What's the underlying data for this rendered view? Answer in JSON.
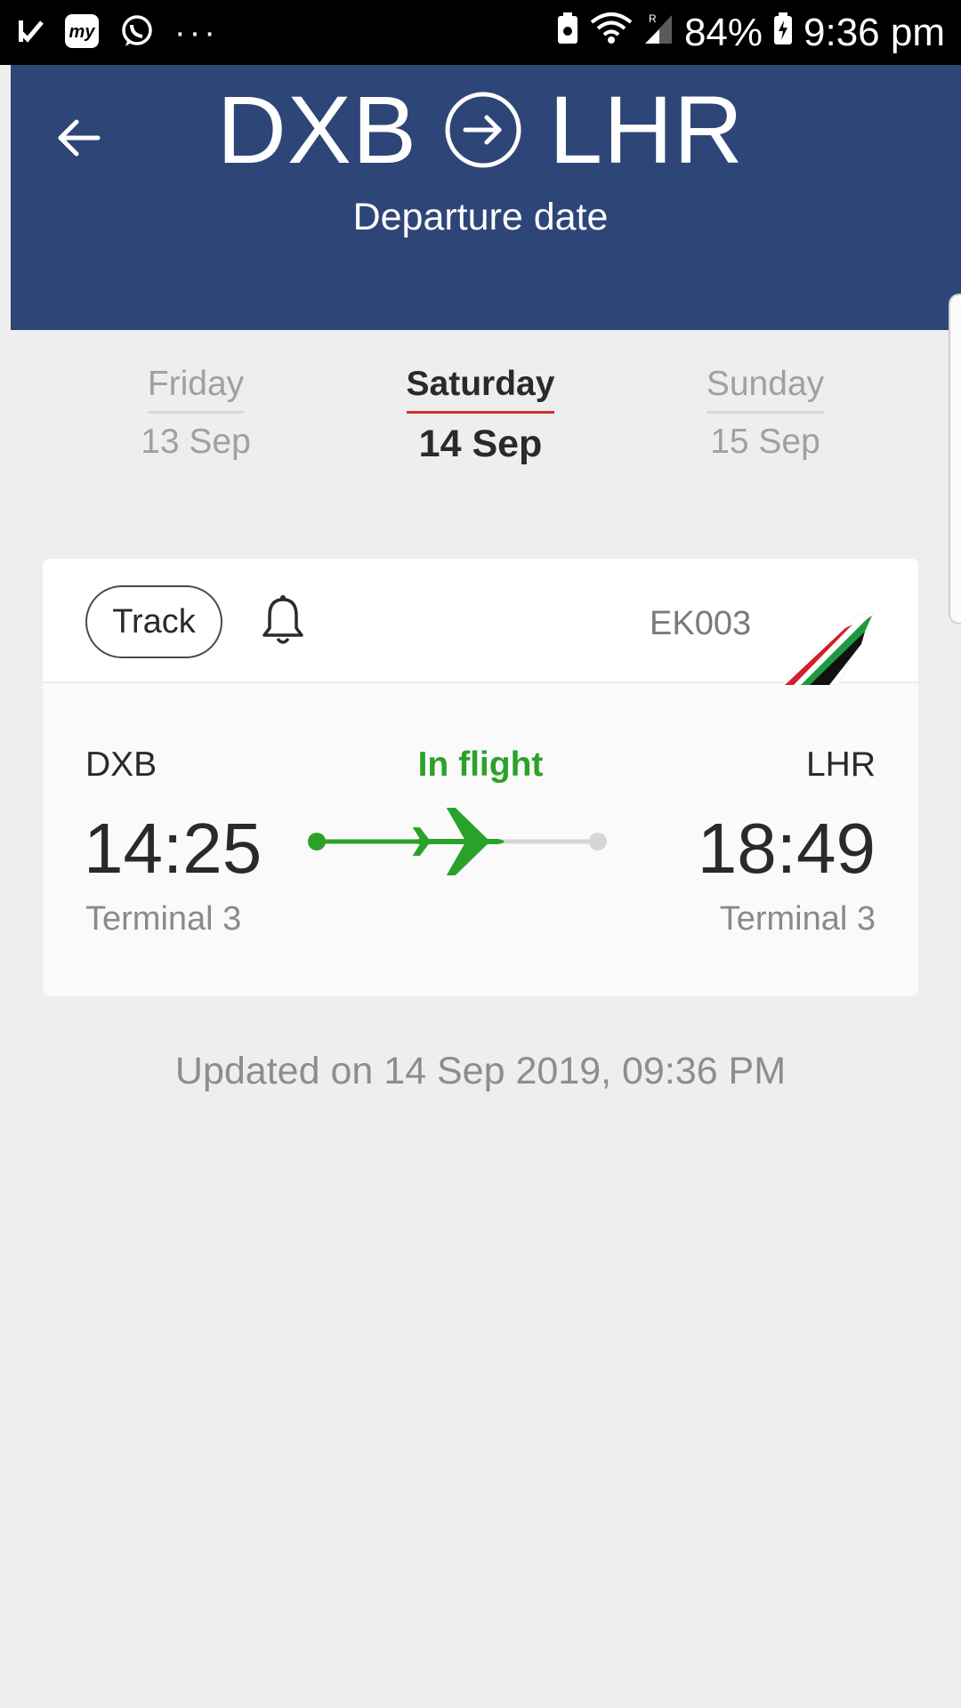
{
  "status_bar": {
    "battery": "84%",
    "time": "9:36 pm",
    "left_icons": [
      "check-icon",
      "my-app-icon",
      "whatsapp-icon",
      "more-dots-icon"
    ],
    "more_label": "···"
  },
  "header": {
    "origin": "DXB",
    "destination": "LHR",
    "subtitle": "Departure date",
    "background_color": "#2e4578"
  },
  "date_tabs": [
    {
      "day": "Friday",
      "date": "13 Sep",
      "selected": false
    },
    {
      "day": "Saturday",
      "date": "14 Sep",
      "selected": true
    },
    {
      "day": "Sunday",
      "date": "15 Sep",
      "selected": false
    }
  ],
  "flight": {
    "track_label": "Track",
    "flight_number": "EK003",
    "status": "In flight",
    "status_color": "#2aa22a",
    "origin": {
      "code": "DXB",
      "time": "14:25",
      "terminal": "Terminal 3"
    },
    "destination": {
      "code": "LHR",
      "time": "18:49",
      "terminal": "Terminal 3"
    },
    "progress": 0.55
  },
  "updated_text": "Updated on 14 Sep 2019, 09:36 PM"
}
